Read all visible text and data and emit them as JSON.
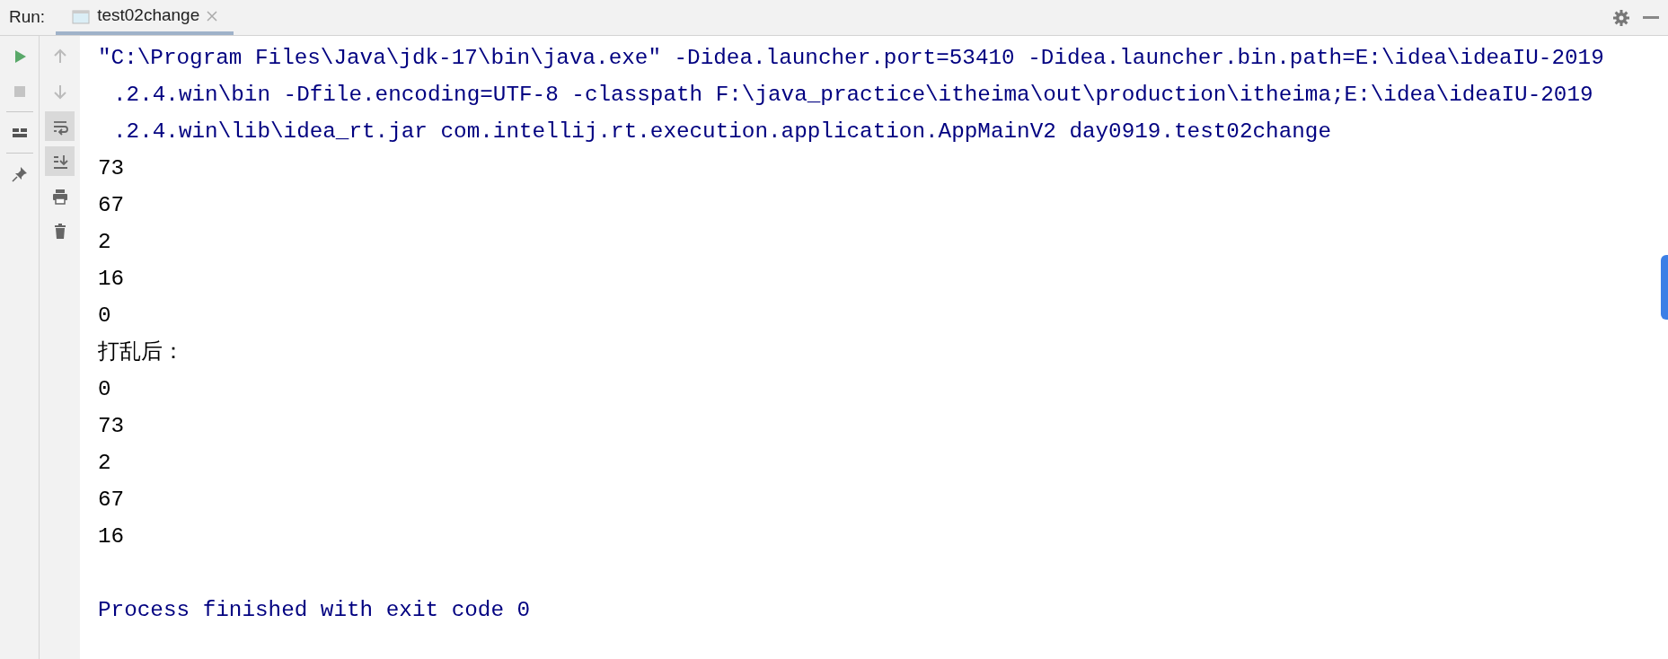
{
  "run_label": "Run:",
  "tabs": [
    {
      "title": "test02change",
      "selected": true
    }
  ],
  "left_tools": [
    {
      "kind": "run"
    },
    {
      "kind": "stop"
    },
    {
      "kind": "layout"
    },
    {
      "kind": "pin"
    }
  ],
  "right_tools": [
    {
      "kind": "up",
      "on": false
    },
    {
      "kind": "down",
      "on": false
    },
    {
      "kind": "wrap",
      "on": true
    },
    {
      "kind": "scroll",
      "on": true
    },
    {
      "kind": "print",
      "on": false
    },
    {
      "kind": "trash",
      "on": false
    }
  ],
  "console": [
    {
      "kind": "command",
      "text": "\"C:\\Program Files\\Java\\jdk-17\\bin\\java.exe\" -Didea.launcher.port=53410 -Didea.launcher.bin.path=E:\\idea\\ideaIU-2019"
    },
    {
      "kind": "wrapped",
      "text": ".2.4.win\\bin -Dfile.encoding=UTF-8 -classpath F:\\java_practice\\itheima\\out\\production\\itheima;E:\\idea\\ideaIU-2019"
    },
    {
      "kind": "wrapped",
      "text": ".2.4.win\\lib\\idea_rt.jar com.intellij.rt.execution.application.AppMainV2 day0919.test02change"
    },
    {
      "kind": "output",
      "text": "73"
    },
    {
      "kind": "output",
      "text": "67"
    },
    {
      "kind": "output",
      "text": "2"
    },
    {
      "kind": "output",
      "text": "16"
    },
    {
      "kind": "output",
      "text": "0"
    },
    {
      "kind": "output",
      "text": "打乱后："
    },
    {
      "kind": "output",
      "text": "0"
    },
    {
      "kind": "output",
      "text": "73"
    },
    {
      "kind": "output",
      "text": "2"
    },
    {
      "kind": "output",
      "text": "67"
    },
    {
      "kind": "output",
      "text": "16"
    },
    {
      "kind": "exit",
      "text": "Process finished with exit code 0"
    }
  ]
}
